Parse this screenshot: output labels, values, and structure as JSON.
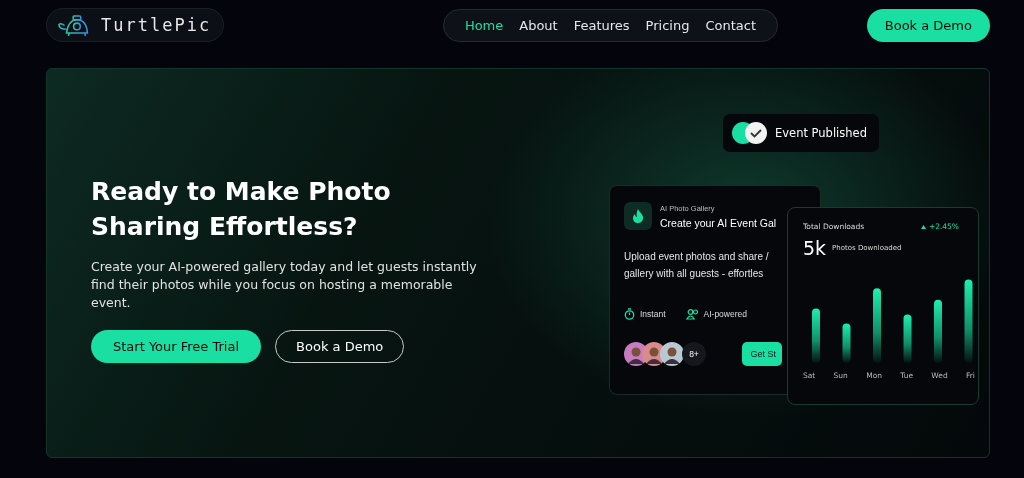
{
  "logo": {
    "text": "TurtlePic"
  },
  "nav": [
    {
      "label": "Home",
      "selected": true
    },
    {
      "label": "About",
      "selected": false
    },
    {
      "label": "Features",
      "selected": false
    },
    {
      "label": "Pricing",
      "selected": false
    },
    {
      "label": "Contact",
      "selected": false
    }
  ],
  "header_button": "Book a Demo",
  "hero": {
    "title": "Ready to Make Photo Sharing Effortless?",
    "text": "Create your AI-powered gallery today and let guests instantly find their photos while you focus on hosting a memorable event.",
    "primary_button": "Start Your Free Trial",
    "secondary_button": "Book a Demo"
  },
  "toast": {
    "text": "Event Published"
  },
  "gallery_card": {
    "eyebrow": "AI Photo Gallery",
    "title": "Create your AI Event Gal",
    "body": [
      "Upload event photos and share /",
      "gallery with all guests - effortles"
    ],
    "features": [
      "Instant",
      "AI-powered"
    ],
    "more": "8+",
    "button": "Get St"
  },
  "downloads_card": {
    "title": "Total Downloads",
    "change": "+2.45%",
    "value": "5k",
    "caption": "Photos Downloaded",
    "days": [
      "Sat",
      "Sun",
      "Mon",
      "Tue",
      "Wed",
      "Fri"
    ]
  }
}
